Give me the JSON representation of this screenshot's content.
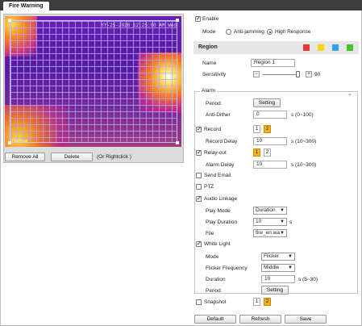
{
  "tab": {
    "label": "Fire Warning"
  },
  "video": {
    "timestamp": "YY-25-2026 12:25:00 AM Wed",
    "channel_label": "Thermal"
  },
  "left_actions": {
    "remove_all": "Remove All",
    "delete": "Delete",
    "hint": "(Or Rightclick )"
  },
  "enable": {
    "label": "Enable",
    "checked": true
  },
  "mode": {
    "label": "Mode",
    "options": [
      "Anti-jamming",
      "High Response"
    ],
    "selected": "High Response"
  },
  "region": {
    "title": "Region",
    "swatches": [
      "#e53935",
      "#f4d41e",
      "#2ca5e8",
      "#43c22b"
    ],
    "name_label": "Name",
    "name_value": "Region 1",
    "sensitivity_label": "Sensitivity",
    "sensitivity_value": "90"
  },
  "alarm": {
    "title": "Alarm",
    "period_label": "Period",
    "period_button": "Setting",
    "anti_dither_label": "Anti-Dither",
    "anti_dither_value": "0",
    "anti_dither_unit": "s (0~100)",
    "record_label": "Record",
    "record_channels": [
      "1",
      "2"
    ],
    "record_delay_label": "Record Delay",
    "record_delay_value": "10",
    "record_delay_unit": "s (10~300)",
    "relay_out_label": "Relay-out",
    "relay_channels": [
      "1",
      "2"
    ],
    "alarm_delay_label": "Alarm Delay",
    "alarm_delay_value": "10",
    "alarm_delay_unit": "s (10~300)",
    "send_email_label": "Send Email",
    "ptz_label": "PTZ",
    "audio_linkage_label": "Audio Linkage",
    "play_mode_label": "Play Mode",
    "play_mode_value": "Duration",
    "play_duration_label": "Play Duration",
    "play_duration_value": "10",
    "play_duration_unit": "s",
    "file_label": "File",
    "file_value": "fire_en.wa",
    "white_light_label": "White Light",
    "wl_mode_label": "Mode",
    "wl_mode_value": "Flicker",
    "flicker_freq_label": "Flicker Frequency",
    "flicker_freq_value": "Middle",
    "wl_duration_label": "Duration",
    "wl_duration_value": "10",
    "wl_duration_unit": "s (5~30)",
    "wl_period_label": "Period",
    "wl_period_button": "Setting",
    "snapshot_label": "Snapshot",
    "snapshot_channels": [
      "1",
      "2"
    ]
  },
  "footer": {
    "default": "Default",
    "refresh": "Refresh",
    "save": "Save"
  }
}
